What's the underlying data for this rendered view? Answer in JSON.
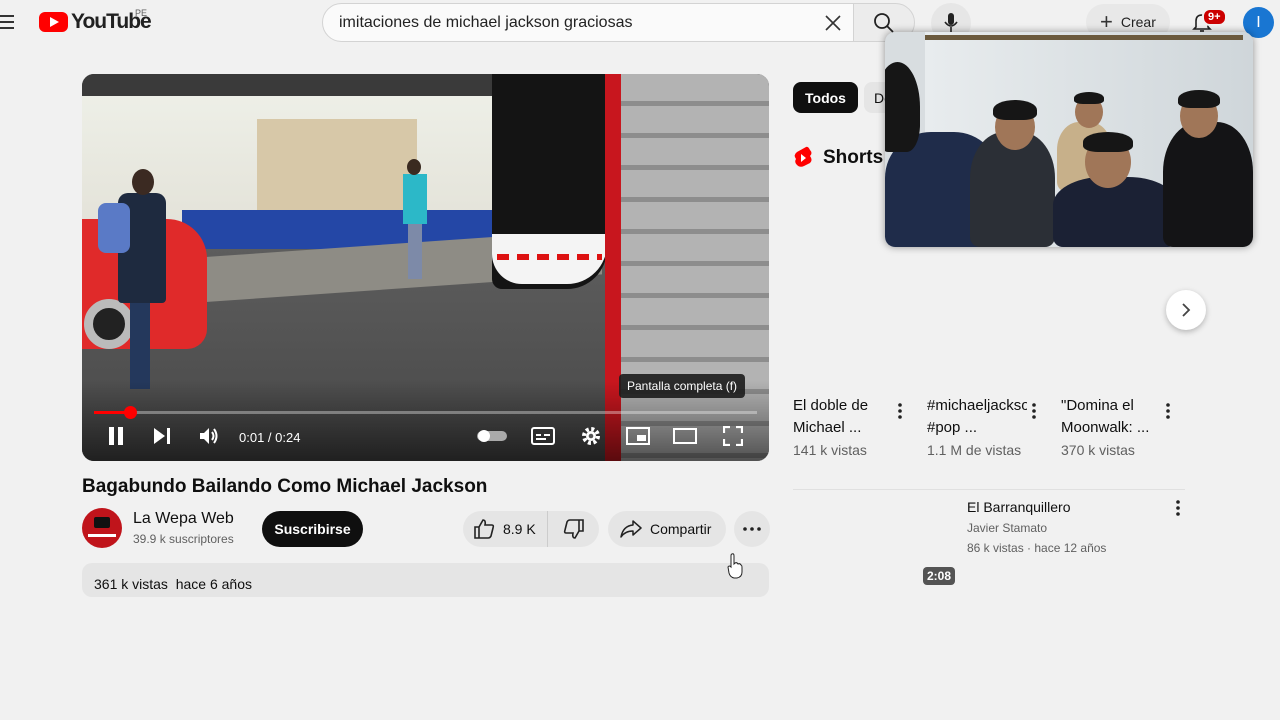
{
  "header": {
    "logo_text": "YouTube",
    "country": "PE",
    "search_query": "imitaciones de michael jackson graciosas",
    "create_label": "Crear",
    "notifications_badge": "9+",
    "avatar_initial": "I"
  },
  "player": {
    "tooltip": "Pantalla completa (f)",
    "time": "0:01 / 0:24",
    "progress_fraction": 0.055
  },
  "video": {
    "title": "Bagabundo Bailando Como Michael Jackson",
    "channel_name": "La Wepa Web",
    "subscribers": "39.9 k suscriptores",
    "subscribe_label": "Suscribirse",
    "likes": "8.9 K",
    "share_label": "Compartir",
    "views": "361 k vistas",
    "age": "hace 6 años"
  },
  "sidebar": {
    "chip_all": "Todos",
    "chip_second": "De",
    "shorts_heading": "Shorts",
    "shorts": [
      {
        "title": "El doble de Michael ...",
        "views": "141 k vistas"
      },
      {
        "title": "#michaeljackson #pop ...",
        "views": "1.1 M de vistas"
      },
      {
        "title": "\"Domina el Moonwalk: ...",
        "views": "370 k vistas"
      }
    ],
    "related": {
      "title": "El Barranquillero",
      "channel": "Javier Stamato",
      "meta": "86 k vistas · hace 12 años",
      "duration": "2:08"
    }
  },
  "colors": {
    "brand_red": "#ff0000",
    "subscribe_bg": "#0f0f0f",
    "chip_active": "#0f0f0f"
  }
}
